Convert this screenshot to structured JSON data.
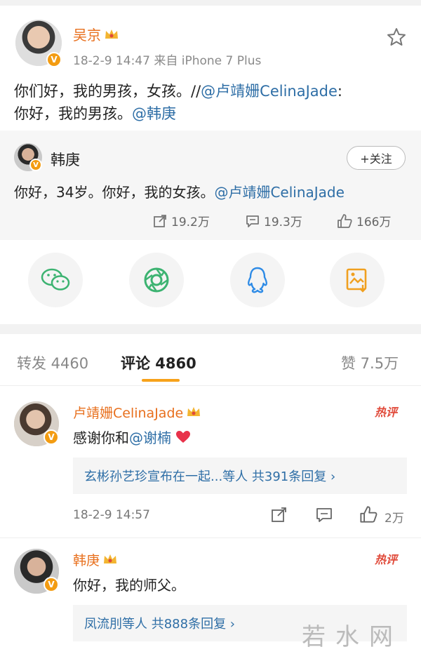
{
  "post": {
    "author": "吴京",
    "meta": "18-2-9 14:47  来自 iPhone 7 Plus",
    "text_prefix": "你们好，我的男孩，女孩。//",
    "mention1": "@卢靖姗CelinaJade",
    "text_mid": ":",
    "text_line2": "你好，我的男孩。",
    "mention2": "@韩庚"
  },
  "repost": {
    "author": "韩庚",
    "follow_label": "+关注",
    "text": "你好，34岁。你好，我的女孩。",
    "mention": "@卢靖姗CelinaJade",
    "reposts": "19.2万",
    "comments": "19.3万",
    "likes": "166万"
  },
  "tabs": {
    "repost": "转发 4460",
    "comment": "评论 4860",
    "like": "赞 7.5万"
  },
  "comments": [
    {
      "author": "卢靖姗CelinaJade",
      "text": "感谢你和",
      "mention": "@谢楠",
      "hot": "热评",
      "reply": "玄彬孙艺珍宣布在一起...等人  共391条回复 ›",
      "time": "18-2-9 14:57",
      "likes": "2万"
    },
    {
      "author": "韩庚",
      "text": "你好，我的师父。",
      "hot": "热评",
      "reply": "凤流刖等人  共888条回复 ›"
    }
  ],
  "watermark": "若水网",
  "icons": {
    "badge": "v-badge-icon",
    "crown": "crown-icon",
    "star": "star-icon",
    "wechat": "wechat-icon",
    "moments": "moments-icon",
    "qq": "qq-icon",
    "save": "save-image-icon",
    "heart": "heart-icon"
  },
  "colors": {
    "accent": "#e8701e",
    "link": "#2e6ea6",
    "tab_underline": "#f7a21b",
    "hot": "#e04a3a"
  }
}
